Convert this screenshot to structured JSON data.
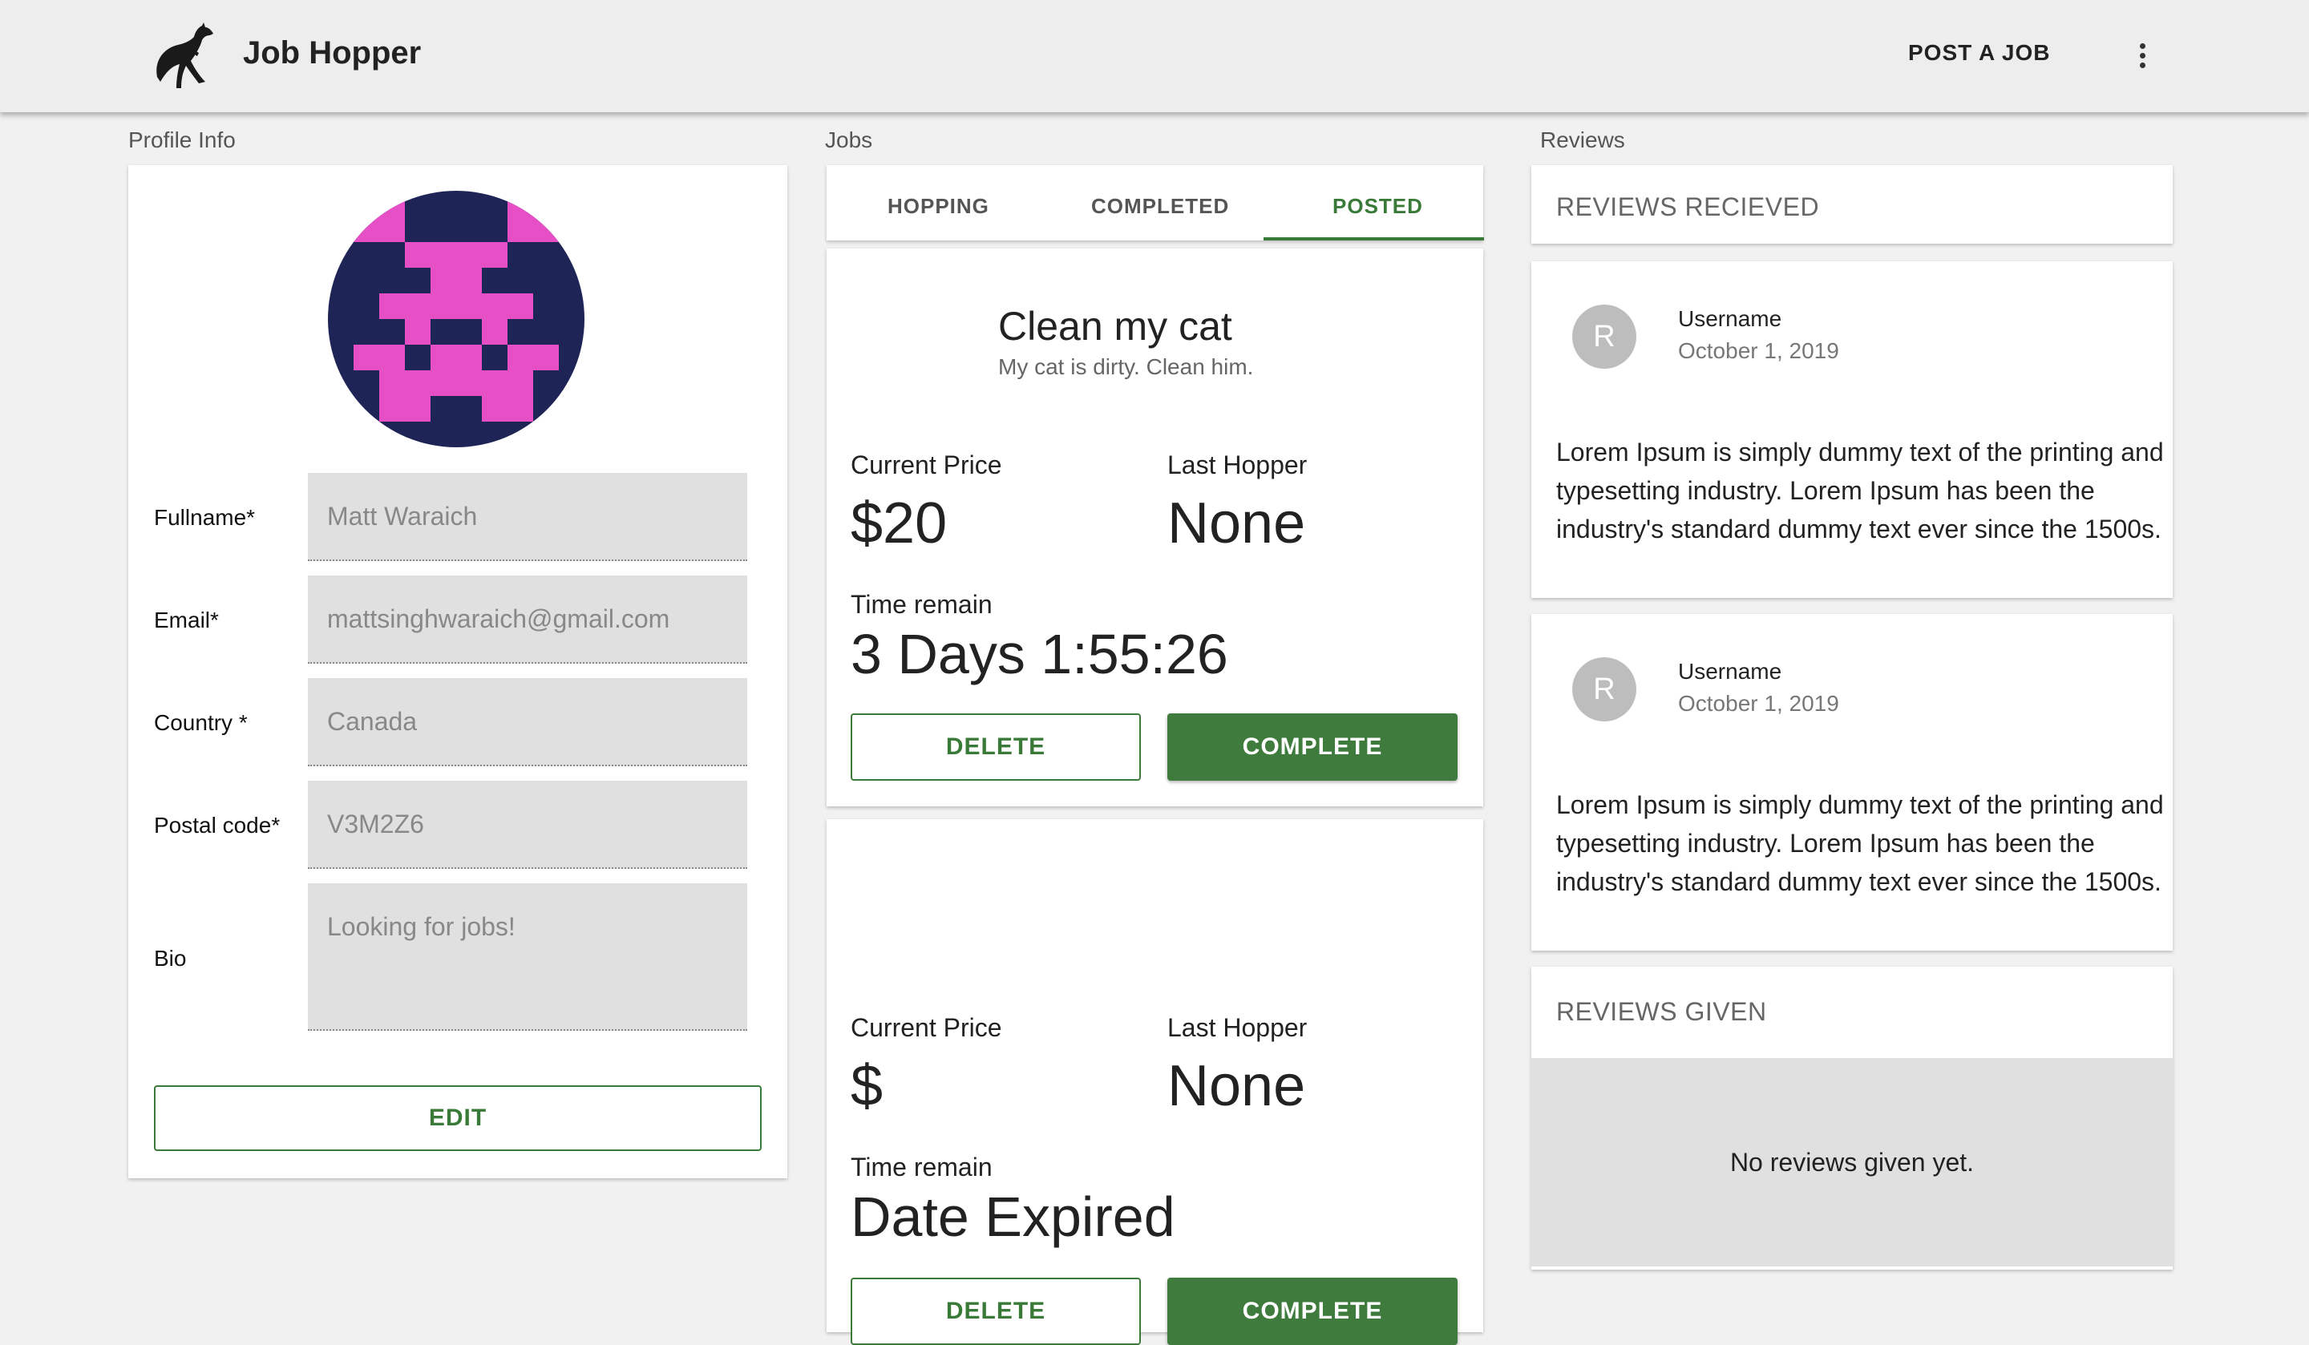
{
  "app": {
    "title": "Job Hopper",
    "post_job_label": "POST A JOB"
  },
  "icons": {
    "logo": "kangaroo-logo",
    "menu": "more-vert-icon"
  },
  "colors": {
    "accent": "#3e7b3c",
    "avatar_bg": "#1f2456",
    "avatar_fg": "#e64fc6"
  },
  "profile": {
    "section_label": "Profile Info",
    "fields": [
      {
        "label": "Fullname*",
        "value": "Matt Waraich"
      },
      {
        "label": "Email*",
        "value": "mattsinghwaraich@gmail.com"
      },
      {
        "label": "Country *",
        "value": "Canada"
      },
      {
        "label": "Postal code*",
        "value": "V3M2Z6"
      },
      {
        "label": "Bio",
        "value": "Looking for jobs!"
      }
    ],
    "edit_label": "EDIT"
  },
  "jobs": {
    "section_label": "Jobs",
    "tabs": [
      {
        "label": "HOPPING"
      },
      {
        "label": "COMPLETED"
      },
      {
        "label": "POSTED"
      }
    ],
    "active_tab": "POSTED",
    "items": [
      {
        "title": "Clean my cat",
        "description": "My cat is dirty. Clean him.",
        "price_label": "Current Price",
        "price": "$20",
        "hopper_label": "Last Hopper",
        "hopper": "None",
        "time_label": "Time remain",
        "time": "3 Days 1:55:26",
        "delete_label": "DELETE",
        "complete_label": "COMPLETE"
      },
      {
        "title": "",
        "description": "",
        "price_label": "Current Price",
        "price": "$",
        "hopper_label": "Last Hopper",
        "hopper": "None",
        "time_label": "Time remain",
        "time": "Date Expired",
        "delete_label": "DELETE",
        "complete_label": "COMPLETE"
      }
    ]
  },
  "reviews": {
    "section_label": "Reviews",
    "received_header": "REVIEWS RECIEVED",
    "received": [
      {
        "initial": "R",
        "username": "Username",
        "date": "October 1, 2019",
        "text": "Lorem Ipsum is simply dummy text of the printing and typesetting industry. Lorem Ipsum has been the industry's standard dummy text ever since the 1500s."
      },
      {
        "initial": "R",
        "username": "Username",
        "date": "October 1, 2019",
        "text": "Lorem Ipsum is simply dummy text of the printing and typesetting industry. Lorem Ipsum has been the industry's standard dummy text ever since the 1500s."
      }
    ],
    "given_header": "REVIEWS GIVEN",
    "given_empty": "No reviews given yet."
  }
}
